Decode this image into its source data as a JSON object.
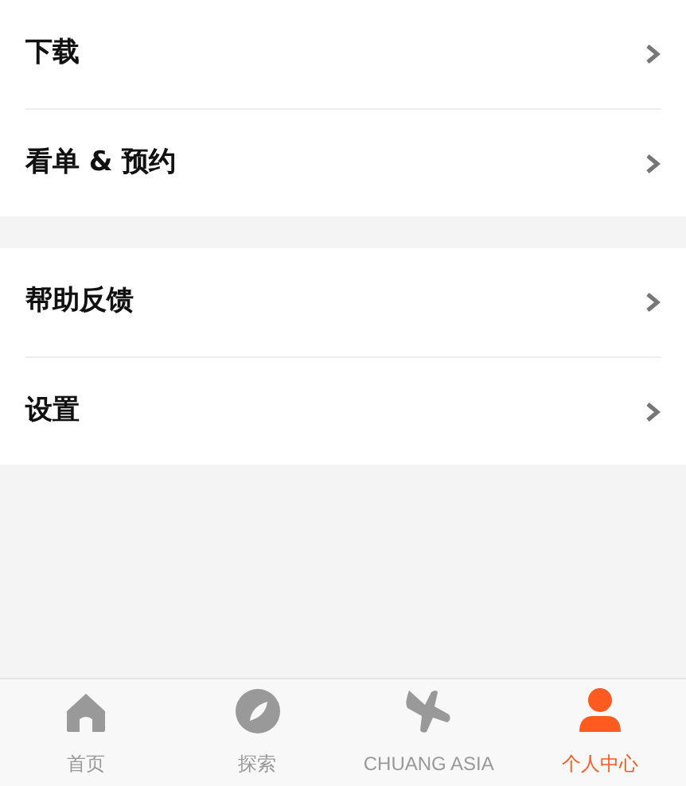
{
  "menu_groups": [
    {
      "items": [
        {
          "label": "下载"
        },
        {
          "label": "看单 & 预约"
        }
      ]
    },
    {
      "items": [
        {
          "label": "帮助反馈"
        },
        {
          "label": "设置"
        }
      ]
    }
  ],
  "tab_bar": [
    {
      "label": "首页",
      "kind": "home",
      "selected": false
    },
    {
      "label": "探索",
      "kind": "explore",
      "selected": false
    },
    {
      "label": "CHUANG ASIA",
      "kind": "pinwheel",
      "selected": false
    },
    {
      "label": "个人中心",
      "kind": "profile",
      "selected": true
    }
  ]
}
